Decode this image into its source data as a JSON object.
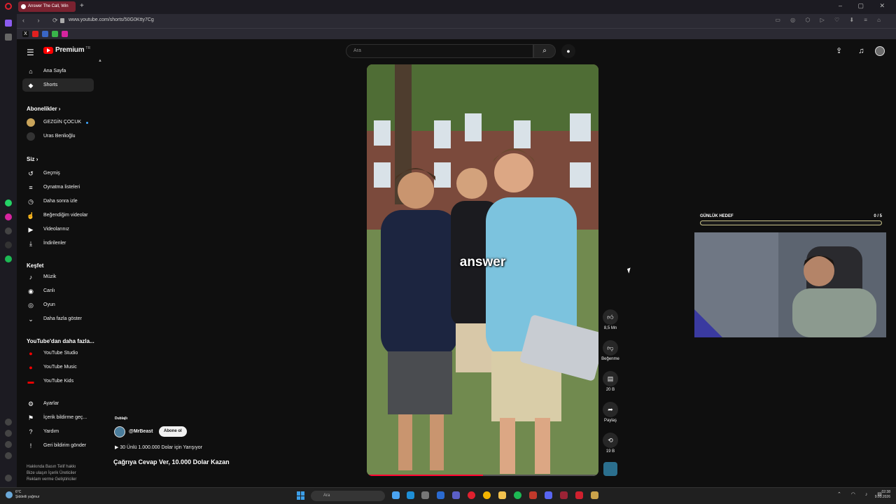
{
  "browser": {
    "tab_title": "Answer The Call, Win",
    "url": "www.youtube.com/shorts/50G0Ktty7Cg",
    "window_controls": "‒ ▢ ✕"
  },
  "youtube": {
    "logo_text": "Premium",
    "logo_sup": "TR",
    "search_placeholder": "Ara",
    "sidebar": {
      "items": [
        {
          "label": "Ana Sayfa",
          "icon": "home-icon"
        },
        {
          "label": "Shorts",
          "icon": "shorts-icon"
        }
      ],
      "subscriptions_header": "Abonelikler",
      "subscriptions": [
        {
          "label": "GEZGİN ÇOCUK"
        },
        {
          "label": "Uras Benlioğlu"
        }
      ],
      "you_header": "Siz",
      "you_items": [
        {
          "label": "Geçmiş"
        },
        {
          "label": "Oynatma listeleri"
        },
        {
          "label": "Daha sonra izle"
        },
        {
          "label": "Beğendiğim videolar"
        },
        {
          "label": "Videolarınız"
        },
        {
          "label": "İndirilenler"
        }
      ],
      "explore_header": "Keşfet",
      "explore_items": [
        {
          "label": "Müzik"
        },
        {
          "label": "Canlı"
        },
        {
          "label": "Oyun"
        },
        {
          "label": "Daha fazla göster"
        }
      ],
      "more_header": "YouTube'dan daha fazla...",
      "more_items": [
        {
          "label": "YouTube Studio"
        },
        {
          "label": "YouTube Music"
        },
        {
          "label": "YouTube Kids"
        }
      ],
      "settings_items": [
        {
          "label": "Ayarlar"
        },
        {
          "label": "İçerik bildirme geç..."
        },
        {
          "label": "Yardım"
        },
        {
          "label": "Geri bildirim gönder"
        }
      ],
      "footer_line1": "Hakkında  Basın  Telif hakkı",
      "footer_line2": "Bize ulaşın  İçerik Üreticiler",
      "footer_line3": "Reklam verme  Geliştiriciler"
    },
    "short": {
      "caption": "answer",
      "progress": 0.5,
      "likes": "8,5 Mn",
      "dislike_label": "Beğenme",
      "comments": "20 B",
      "share_label": "Paylaş",
      "remix": "19 B",
      "dubbed_label": "Dublajlı",
      "channel": "@MrBeast",
      "subscribe_label": "Abone ol",
      "playlist": "▶ 30 Ünlü 1.000.000 Dolar için Yarışıyor",
      "title": "Çağrıya Cevap Ver, 10.000 Dolar Kazan"
    }
  },
  "overlay": {
    "goal_label": "GÜNLÜK HEDEF",
    "goal_count": "0 / 5",
    "goal_progress": 0
  },
  "taskbar": {
    "weather_temp": "6°C",
    "weather_desc": "Şiddetli yağmur",
    "search_placeholder": "Ara",
    "time": "02:38",
    "date": "9.03.2026"
  }
}
